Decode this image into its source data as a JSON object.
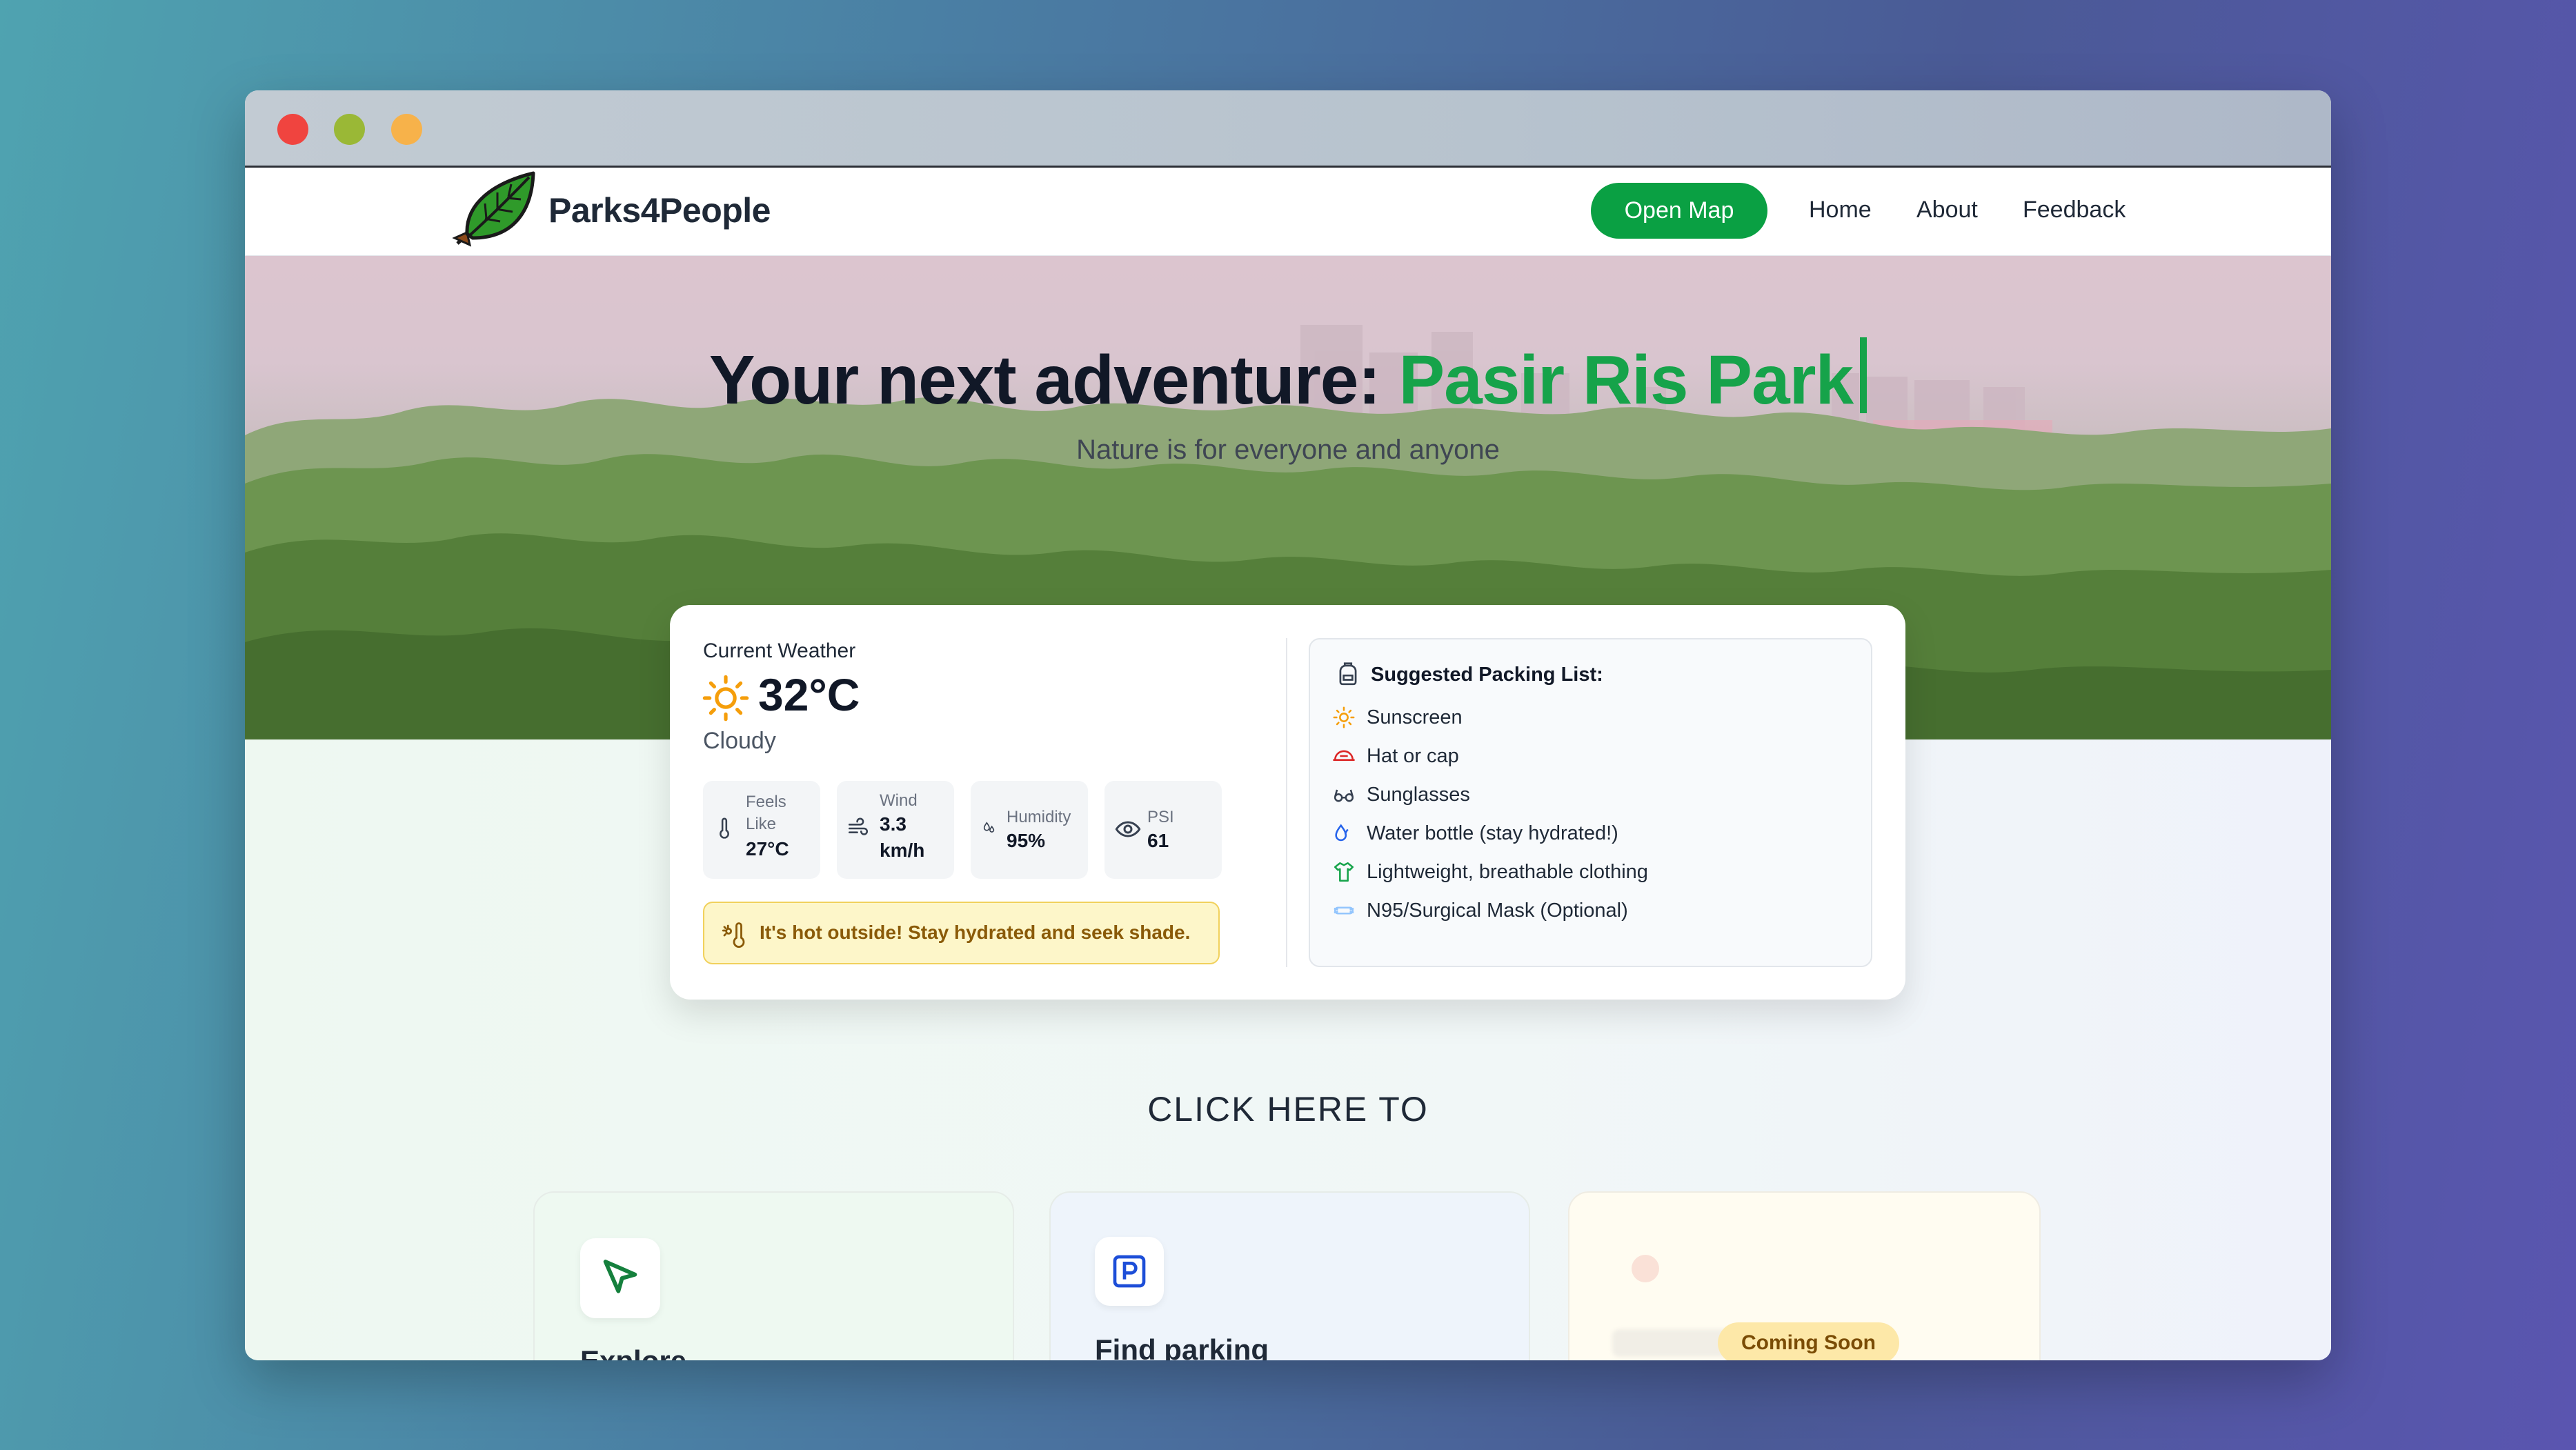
{
  "app": {
    "brand": "Parks4People"
  },
  "nav": {
    "open_map": "Open Map",
    "home": "Home",
    "about": "About",
    "feedback": "Feedback"
  },
  "hero": {
    "title_prefix": "Your next adventure: ",
    "park_name": "Pasir Ris Park",
    "subtitle": "Nature is for everyone and anyone"
  },
  "weather": {
    "label": "Current Weather",
    "temperature": "32°C",
    "condition": "Cloudy",
    "icon": "sun-icon",
    "stats": {
      "feels_like": {
        "label_line1": "Feels",
        "label_line2": "Like",
        "value": "27°C",
        "icon": "thermometer-icon"
      },
      "wind": {
        "label": "Wind",
        "value_line1": "3.3",
        "value_line2": "km/h",
        "icon": "wind-icon"
      },
      "humidity": {
        "label": "Humidity",
        "value": "95%",
        "icon": "droplets-icon"
      },
      "psi": {
        "label": "PSI",
        "value": "61",
        "icon": "eye-icon"
      }
    },
    "alert": "It's hot outside! Stay hydrated and seek shade."
  },
  "packing": {
    "title": "Suggested Packing List:",
    "items": [
      {
        "label": "Sunscreen",
        "icon": "sun-icon",
        "color": "#f59e0b"
      },
      {
        "label": "Hat or cap",
        "icon": "cap-icon",
        "color": "#dc2626"
      },
      {
        "label": "Sunglasses",
        "icon": "glasses-icon",
        "color": "#374151"
      },
      {
        "label": "Water bottle (stay hydrated!)",
        "icon": "droplet-icon",
        "color": "#2563eb"
      },
      {
        "label": "Lightweight, breathable clothing",
        "icon": "shirt-icon",
        "color": "#16a34a"
      },
      {
        "label": "N95/Surgical Mask (Optional)",
        "icon": "mask-icon",
        "color": "#93c5fd"
      }
    ]
  },
  "cta": {
    "heading": "CLICK HERE TO"
  },
  "tiles": {
    "explore": {
      "title": "Explore",
      "icon": "navigation-arrow-icon"
    },
    "parking": {
      "title": "Find parking",
      "icon": "parking-icon"
    },
    "soon": {
      "badge": "Coming Soon"
    }
  },
  "colors": {
    "accent_green": "#16a34a",
    "button_green": "#0aa043",
    "alert_bg": "#fdf6c9",
    "alert_text": "#8a5a08"
  }
}
